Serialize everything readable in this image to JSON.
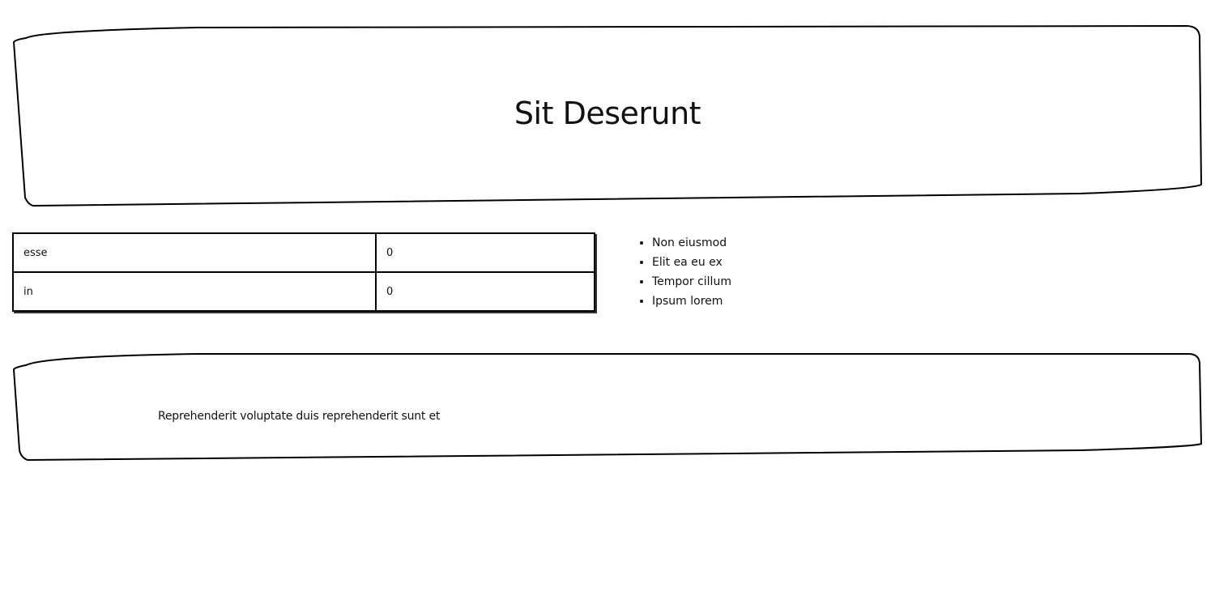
{
  "header": {
    "title": "Sit Deserunt"
  },
  "table": {
    "rows": [
      {
        "key": "esse",
        "value": "0"
      },
      {
        "key": "in",
        "value": "0"
      }
    ]
  },
  "list": {
    "items": [
      "Non eiusmod",
      "Elit ea eu ex",
      "Tempor cillum",
      "Ipsum lorem"
    ]
  },
  "footer": {
    "text": "Reprehenderit voluptate duis reprehenderit sunt et"
  }
}
